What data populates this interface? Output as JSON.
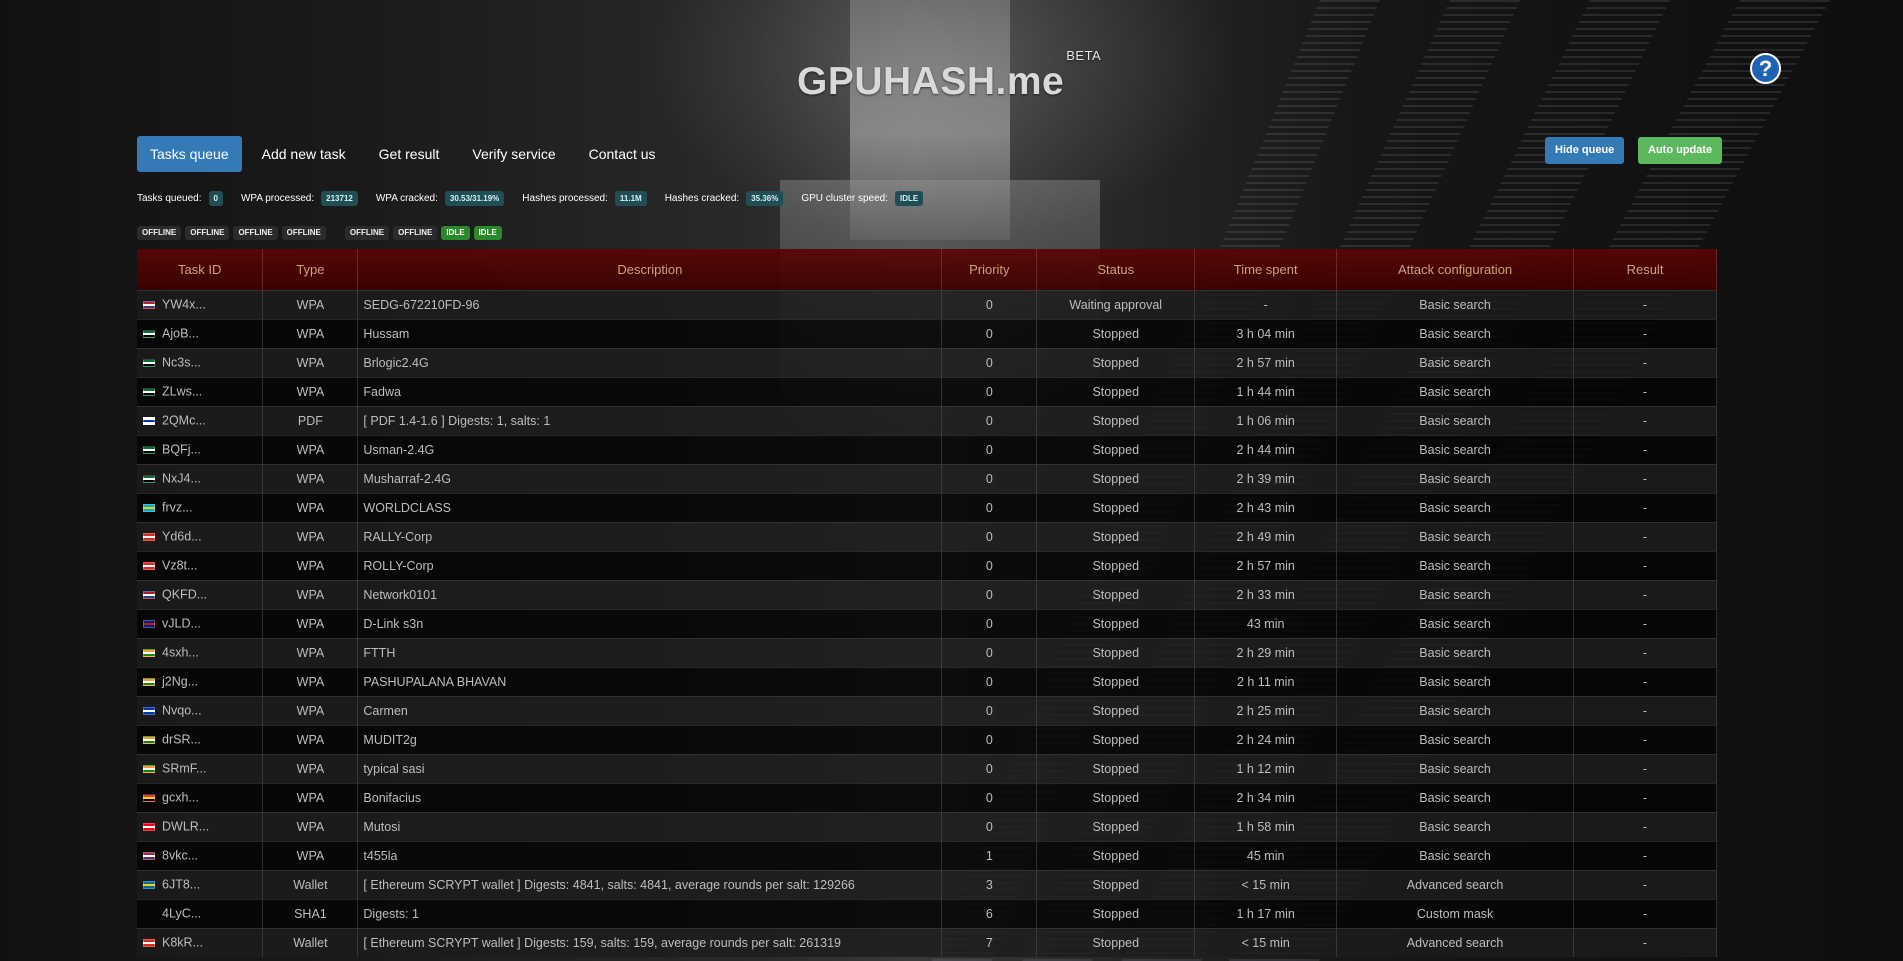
{
  "header": {
    "logo": "GPUHASH.me",
    "beta": "BETA",
    "help_glyph": "?"
  },
  "nav": {
    "items": [
      {
        "label": "Tasks queue",
        "active": true
      },
      {
        "label": "Add new task",
        "active": false
      },
      {
        "label": "Get result",
        "active": false
      },
      {
        "label": "Verify service",
        "active": false
      },
      {
        "label": "Contact us",
        "active": false
      }
    ]
  },
  "buttons": {
    "hide_queue": "Hide queue",
    "auto_update": "Auto update"
  },
  "stats": [
    {
      "label": "Tasks queued:",
      "value": "0"
    },
    {
      "label": "WPA processed:",
      "value": "213712"
    },
    {
      "label": "WPA cracked:",
      "value": "30.53/31.19%"
    },
    {
      "label": "Hashes processed:",
      "value": "11.1M"
    },
    {
      "label": "Hashes cracked:",
      "value": "35.36%"
    },
    {
      "label": "GPU cluster speed:",
      "value": "IDLE"
    }
  ],
  "nodes": [
    "OFFLINE",
    "OFFLINE",
    "OFFLINE",
    "OFFLINE",
    "OFFLINE",
    "OFFLINE",
    "IDLE",
    "IDLE"
  ],
  "table": {
    "headers": [
      "Task ID",
      "Type",
      "Description",
      "Priority",
      "Status",
      "Time spent",
      "Attack configuration",
      "Result"
    ],
    "rows": [
      {
        "flag": [
          "#b22234",
          "#ffffff",
          "#3c3b6e"
        ],
        "id": "YW4x...",
        "type": "WPA",
        "desc": "SEDG-672210FD-96",
        "priority": "0",
        "status": "Waiting approval",
        "time": "-",
        "attack": "Basic search",
        "result": "-"
      },
      {
        "flag": [
          "#00732f",
          "#ffffff",
          "#000000"
        ],
        "id": "AjoB...",
        "type": "WPA",
        "desc": "Hussam",
        "priority": "0",
        "status": "Stopped",
        "time": "3 h 04 min",
        "attack": "Basic search",
        "result": "-"
      },
      {
        "flag": [
          "#00732f",
          "#ffffff",
          "#000000"
        ],
        "id": "Nc3s...",
        "type": "WPA",
        "desc": "Brlogic2.4G",
        "priority": "0",
        "status": "Stopped",
        "time": "2 h 57 min",
        "attack": "Basic search",
        "result": "-"
      },
      {
        "flag": [
          "#00732f",
          "#ffffff",
          "#000000"
        ],
        "id": "ZLws...",
        "type": "WPA",
        "desc": "Fadwa",
        "priority": "0",
        "status": "Stopped",
        "time": "1 h 44 min",
        "attack": "Basic search",
        "result": "-"
      },
      {
        "flag": [
          "#ffffff",
          "#0038b8",
          "#ffffff"
        ],
        "id": "2QMc...",
        "type": "PDF",
        "desc": "[ PDF 1.4-1.6 ] Digests: 1, salts: 1",
        "priority": "0",
        "status": "Stopped",
        "time": "1 h 06 min",
        "attack": "Basic search",
        "result": "-"
      },
      {
        "flag": [
          "#00732f",
          "#ffffff",
          "#000000"
        ],
        "id": "BQFj...",
        "type": "WPA",
        "desc": "Usman-2.4G",
        "priority": "0",
        "status": "Stopped",
        "time": "2 h 44 min",
        "attack": "Basic search",
        "result": "-"
      },
      {
        "flag": [
          "#00732f",
          "#ffffff",
          "#000000"
        ],
        "id": "NxJ4...",
        "type": "WPA",
        "desc": "Musharraf-2.4G",
        "priority": "0",
        "status": "Stopped",
        "time": "2 h 39 min",
        "attack": "Basic search",
        "result": "-"
      },
      {
        "flag": [
          "#00afca",
          "#fec50c",
          "#00afca"
        ],
        "id": "frvz...",
        "type": "WPA",
        "desc": "WORLDCLASS",
        "priority": "0",
        "status": "Stopped",
        "time": "2 h 43 min",
        "attack": "Basic search",
        "result": "-"
      },
      {
        "flag": [
          "#d52b1e",
          "#ffffff",
          "#d52b1e"
        ],
        "id": "Yd6d...",
        "type": "WPA",
        "desc": "RALLY-Corp",
        "priority": "0",
        "status": "Stopped",
        "time": "2 h 49 min",
        "attack": "Basic search",
        "result": "-"
      },
      {
        "flag": [
          "#d52b1e",
          "#ffffff",
          "#d52b1e"
        ],
        "id": "Vz8t...",
        "type": "WPA",
        "desc": "ROLLY-Corp",
        "priority": "0",
        "status": "Stopped",
        "time": "2 h 57 min",
        "attack": "Basic search",
        "result": "-"
      },
      {
        "flag": [
          "#ae1c28",
          "#ffffff",
          "#21468b"
        ],
        "id": "QKFD...",
        "type": "WPA",
        "desc": "Network0101",
        "priority": "0",
        "status": "Stopped",
        "time": "2 h 33 min",
        "attack": "Basic search",
        "result": "-"
      },
      {
        "flag": [
          "#012169",
          "#c8102e",
          "#012169"
        ],
        "id": "vJLD...",
        "type": "WPA",
        "desc": "D-Link s3n",
        "priority": "0",
        "status": "Stopped",
        "time": "43 min",
        "attack": "Basic search",
        "result": "-"
      },
      {
        "flag": [
          "#ff9933",
          "#ffffff",
          "#138808"
        ],
        "id": "4sxh...",
        "type": "WPA",
        "desc": "FTTH",
        "priority": "0",
        "status": "Stopped",
        "time": "2 h 29 min",
        "attack": "Basic search",
        "result": "-"
      },
      {
        "flag": [
          "#ff9933",
          "#ffffff",
          "#138808"
        ],
        "id": "j2Ng...",
        "type": "WPA",
        "desc": "PASHUPALANA BHAVAN",
        "priority": "0",
        "status": "Stopped",
        "time": "2 h 11 min",
        "attack": "Basic search",
        "result": "-"
      },
      {
        "flag": [
          "#0038a8",
          "#ffffff",
          "#0038a8"
        ],
        "id": "Nvqo...",
        "type": "WPA",
        "desc": "Carmen",
        "priority": "0",
        "status": "Stopped",
        "time": "2 h 25 min",
        "attack": "Basic search",
        "result": "-"
      },
      {
        "flag": [
          "#ff9933",
          "#ffffff",
          "#138808"
        ],
        "id": "drSR...",
        "type": "WPA",
        "desc": "MUDIT2g",
        "priority": "0",
        "status": "Stopped",
        "time": "2 h 24 min",
        "attack": "Basic search",
        "result": "-"
      },
      {
        "flag": [
          "#ff9933",
          "#ffffff",
          "#138808"
        ],
        "id": "SRmF...",
        "type": "WPA",
        "desc": "typical sasi",
        "priority": "0",
        "status": "Stopped",
        "time": "1 h 12 min",
        "attack": "Basic search",
        "result": "-"
      },
      {
        "flag": [
          "#ef3340",
          "#fcd116",
          "#000000"
        ],
        "id": "gcxh...",
        "type": "WPA",
        "desc": "Bonifacius",
        "priority": "0",
        "status": "Stopped",
        "time": "2 h 34 min",
        "attack": "Basic search",
        "result": "-"
      },
      {
        "flag": [
          "#e70013",
          "#ffffff",
          "#e70013"
        ],
        "id": "DWLR...",
        "type": "WPA",
        "desc": "Mutosi",
        "priority": "0",
        "status": "Stopped",
        "time": "1 h 58 min",
        "attack": "Basic search",
        "result": "-"
      },
      {
        "flag": [
          "#b22234",
          "#ffffff",
          "#3c3b6e"
        ],
        "id": "8vkc...",
        "type": "WPA",
        "desc": "t455la",
        "priority": "1",
        "status": "Stopped",
        "time": "45 min",
        "attack": "Basic search",
        "result": "-"
      },
      {
        "flag": [
          "#006aa7",
          "#fecc00",
          "#006aa7"
        ],
        "id": "6JT8...",
        "type": "Wallet",
        "desc": "[ Ethereum SCRYPT wallet ] Digests: 4841, salts: 4841, average rounds per salt: 129266",
        "priority": "3",
        "status": "Stopped",
        "time": "< 15 min",
        "attack": "Advanced search",
        "result": "-"
      },
      {
        "flag": null,
        "id": "4LyC...",
        "type": "SHA1",
        "desc": "Digests: 1",
        "priority": "6",
        "status": "Stopped",
        "time": "1 h 17 min",
        "attack": "Custom mask",
        "result": "-"
      },
      {
        "flag": [
          "#d52b1e",
          "#ffffff",
          "#d52b1e"
        ],
        "id": "K8kR...",
        "type": "Wallet",
        "desc": "[ Ethereum SCRYPT wallet ] Digests: 159, salts: 159, average rounds per salt: 261319",
        "priority": "7",
        "status": "Stopped",
        "time": "< 15 min",
        "attack": "Advanced search",
        "result": "-"
      }
    ]
  }
}
